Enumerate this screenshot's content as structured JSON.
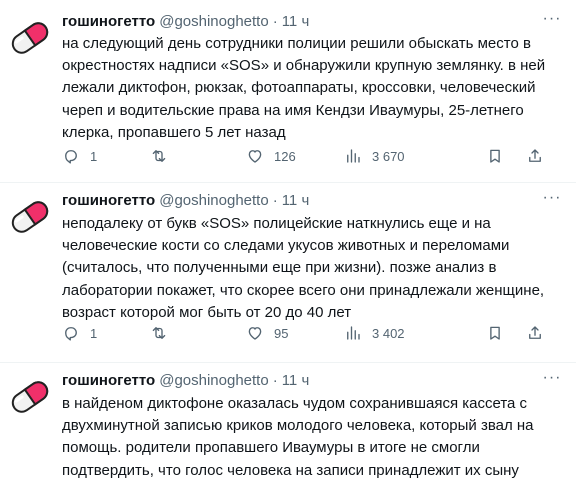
{
  "tweets": [
    {
      "name": "гошиногетто",
      "handle": "@goshinoghetto",
      "time": "11 ч",
      "text": "на следующий день сотрудники полиции решили обыскать место в окрестностях надписи «SOS» и обнаружили крупную землянку. в ней лежали диктофон, рюкзак, фотоаппараты, кроссовки, человеческий череп и водительские права на имя Кендзи Иваумуры, 25-летнего клерка, пропавшего 5 лет назад",
      "replies": "1",
      "retweets": "",
      "likes": "126",
      "views": "3 670"
    },
    {
      "name": "гошиногетто",
      "handle": "@goshinoghetto",
      "time": "11 ч",
      "text": "неподалеку от букв «SOS» полицейские наткнулись еще и на человеческие кости со следами укусов животных и переломами (считалось, что полученными еще при жизни). позже анализ в лаборатории покажет, что скорее всего они принадлежали женщине, возраст которой мог быть от 20 до 40 лет",
      "replies": "1",
      "retweets": "",
      "likes": "95",
      "views": "3 402"
    },
    {
      "name": "гошиногетто",
      "handle": "@goshinoghetto",
      "time": "11 ч",
      "text": "в найденом диктофоне оказалась чудом сохранившаяся кассета с двухминутной записью криков молодого человека, который звал на помощь. родители пропавшего Иваумуры в итоге не смогли подтвердить, что голос человека на записи принадлежит их сыну"
    }
  ],
  "icons": {
    "avatar": "pill-capsule-icon",
    "more": "more-dots-icon",
    "reply": "reply-icon",
    "retweet": "retweet-icon",
    "like": "heart-icon",
    "views": "views-icon",
    "bookmark": "bookmark-icon",
    "share": "share-icon"
  },
  "colors": {
    "text": "#0f1419",
    "secondary": "#536471",
    "capsule_pink": "#f0306a",
    "capsule_white": "#f2f2f2"
  },
  "separators": {
    "dot": "·",
    "more": "···"
  }
}
